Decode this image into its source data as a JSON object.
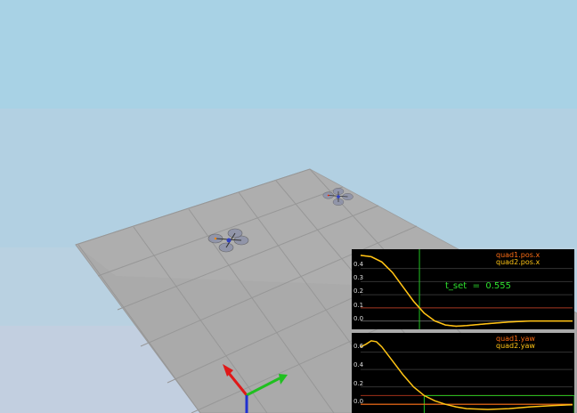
{
  "scene": {
    "colors": {
      "sky": "#a8d2e5",
      "ground": "#aaaaaa",
      "axis_x": "#e01818",
      "axis_y": "#20c020",
      "axis_z": "#2030d0"
    },
    "drones": [
      {
        "name": "quad1"
      },
      {
        "name": "quad2"
      }
    ]
  },
  "plots": [
    {
      "id": "pos",
      "legend": [
        "quad1.pos.x",
        "quad2.pos.x"
      ],
      "y_ticks": [
        "0.4",
        "0.3",
        "0.2",
        "0.1",
        "0.0"
      ],
      "annotation": {
        "label": "t_set",
        "eq": "=",
        "value": "0.555"
      },
      "chart_data": {
        "type": "line",
        "x": [
          0,
          0.1,
          0.2,
          0.3,
          0.4,
          0.5,
          0.6,
          0.7,
          0.8,
          0.9,
          1.0,
          1.2,
          1.4,
          1.6,
          1.8,
          2.0
        ],
        "series": [
          {
            "name": "quad1.pos.x",
            "values": [
              0.5,
              0.49,
              0.45,
              0.37,
              0.26,
              0.15,
              0.06,
              0.0,
              -0.03,
              -0.04,
              -0.035,
              -0.02,
              -0.008,
              0.0,
              0.0,
              0.0
            ]
          },
          {
            "name": "quad2.pos.x",
            "values": [
              0.5,
              0.49,
              0.45,
              0.37,
              0.26,
              0.15,
              0.06,
              0.0,
              -0.03,
              -0.04,
              -0.035,
              -0.02,
              -0.008,
              0.0,
              0.0,
              0.0
            ]
          }
        ],
        "ylim": [
          -0.05,
          0.52
        ],
        "marker_x": 0.555,
        "ref_lines": [
          0.1,
          0.0
        ]
      }
    },
    {
      "id": "yaw",
      "legend": [
        "quad1.yaw",
        "quad2.yaw"
      ],
      "y_ticks": [
        "0.6",
        "0.4",
        "0.2",
        "0.0"
      ],
      "chart_data": {
        "type": "line",
        "x": [
          0,
          0.05,
          0.1,
          0.15,
          0.2,
          0.3,
          0.4,
          0.5,
          0.6,
          0.7,
          0.8,
          0.9,
          1.0,
          1.2,
          1.4,
          1.6,
          1.8,
          2.0
        ],
        "series": [
          {
            "name": "quad1.yaw",
            "values": [
              0.0,
              0.0,
              0.0,
              0.0,
              0.0,
              0.0,
              0.0,
              0.0,
              0.0,
              0.0,
              0.0,
              0.0,
              0.0,
              0.0,
              0.0,
              0.0,
              0.0,
              0.0
            ]
          },
          {
            "name": "quad2.yaw",
            "values": [
              0.66,
              0.69,
              0.73,
              0.72,
              0.66,
              0.5,
              0.34,
              0.2,
              0.1,
              0.04,
              0.0,
              -0.03,
              -0.05,
              -0.06,
              -0.05,
              -0.03,
              -0.015,
              -0.005
            ]
          }
        ],
        "ylim": [
          -0.08,
          0.78
        ],
        "ref_lines": [
          0.1
        ]
      }
    }
  ]
}
